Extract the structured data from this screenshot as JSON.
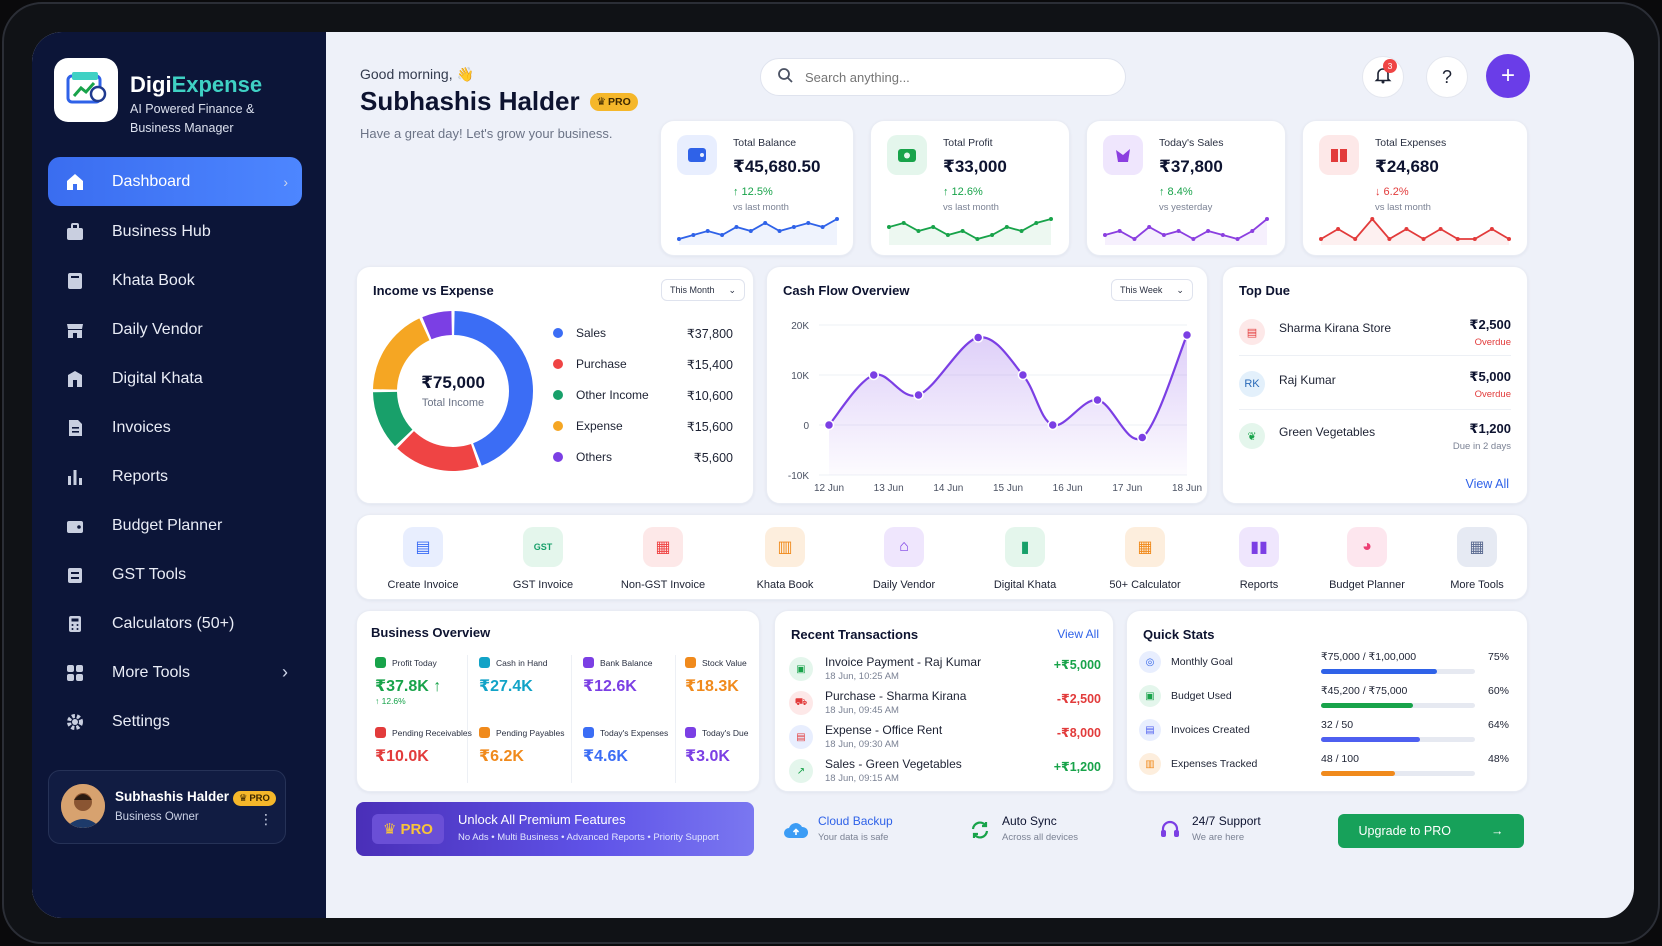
{
  "app": {
    "brand_a": "Digi",
    "brand_b": "Expense",
    "subtitle": "AI Powered Finance & Business Manager"
  },
  "sidebar": {
    "items": [
      {
        "label": "Dashboard",
        "icon": "home-icon"
      },
      {
        "label": "Business Hub",
        "icon": "briefcase-icon"
      },
      {
        "label": "Khata Book",
        "icon": "book-icon"
      },
      {
        "label": "Daily Vendor",
        "icon": "store-icon"
      },
      {
        "label": "Digital Khata",
        "icon": "ledger-icon"
      },
      {
        "label": "Invoices",
        "icon": "invoice-icon"
      },
      {
        "label": "Reports",
        "icon": "bar-chart-icon"
      },
      {
        "label": "Budget Planner",
        "icon": "wallet-icon"
      },
      {
        "label": "GST Tools",
        "icon": "gst-icon"
      },
      {
        "label": "Calculators (50+)",
        "icon": "calculator-icon"
      },
      {
        "label": "More Tools",
        "icon": "grid-icon"
      },
      {
        "label": "Settings",
        "icon": "gear-icon"
      }
    ],
    "user": {
      "name": "Subhashis Halder",
      "role": "Business Owner",
      "badge": "PRO"
    }
  },
  "header": {
    "greeting": "Good morning, 👋",
    "name": "Subhashis Halder",
    "badge": "PRO",
    "tagline": "Have a great day! Let's grow your business.",
    "search_placeholder": "Search anything...",
    "notif_count": "3",
    "help": "?",
    "add": "+"
  },
  "kpis": [
    {
      "label": "Total Balance",
      "value": "₹45,680.50",
      "change": "↑ 12.5%",
      "cmp": "vs last month",
      "color": "#2f62e8",
      "trend": [
        3,
        4,
        5,
        4,
        6,
        5,
        7,
        5,
        6,
        7,
        6,
        8
      ]
    },
    {
      "label": "Total Profit",
      "value": "₹33,000",
      "change": "↑ 12.6%",
      "cmp": "vs last month",
      "color": "#18a34a",
      "trend": [
        5,
        6,
        4,
        5,
        3,
        4,
        2,
        3,
        5,
        4,
        6,
        7
      ]
    },
    {
      "label": "Today's Sales",
      "value": "₹37,800",
      "change": "↑ 8.4%",
      "cmp": "vs yesterday",
      "color": "#8b3fe0",
      "trend": [
        4,
        5,
        3,
        6,
        4,
        5,
        3,
        5,
        4,
        3,
        5,
        8
      ]
    },
    {
      "label": "Total Expenses",
      "value": "₹24,680",
      "change": "↓ 6.2%",
      "cmp": "vs last month",
      "color": "#e23b3b",
      "trend": [
        4,
        5,
        4,
        6,
        4,
        5,
        4,
        5,
        4,
        4,
        5,
        4
      ]
    }
  ],
  "income_expense": {
    "title": "Income vs Expense",
    "period": "This Month",
    "total": "₹75,000",
    "total_label": "Total Income",
    "items": [
      {
        "label": "Sales",
        "value": "₹37,800",
        "amount": 37800,
        "color": "#3b6df5"
      },
      {
        "label": "Purchase",
        "value": "₹15,400",
        "amount": 15400,
        "color": "#ef4444"
      },
      {
        "label": "Other Income",
        "value": "₹10,600",
        "amount": 10600,
        "color": "#18a06a"
      },
      {
        "label": "Expense",
        "value": "₹15,600",
        "amount": 15600,
        "color": "#f5a623"
      },
      {
        "label": "Others",
        "value": "₹5,600",
        "amount": 5600,
        "color": "#7b3fe4"
      }
    ]
  },
  "chart_data": {
    "type": "line",
    "title": "Cash Flow Overview",
    "period": "This Week",
    "x": [
      "12 Jun",
      "13 Jun",
      "14 Jun",
      "15 Jun",
      "16 Jun",
      "17 Jun",
      "18 Jun"
    ],
    "series": [
      {
        "values": [
          0,
          10000,
          6000,
          17500,
          10000,
          0,
          5000,
          -2500,
          18000
        ]
      }
    ],
    "points_x": [
      0,
      0.75,
      1.5,
      2.5,
      3.25,
      3.75,
      4.5,
      5.25,
      6
    ],
    "yticks": [
      "20K",
      "10K",
      "0",
      "-10K"
    ],
    "ylim": [
      -10000,
      20000
    ],
    "color": "#7b3fe4"
  },
  "top_due": {
    "title": "Top Due",
    "items": [
      {
        "name": "Sharma Kirana Store",
        "amount": "₹2,500",
        "status": "Overdue",
        "icon": "store-icon",
        "initials": "",
        "status_color": "#e23b3b"
      },
      {
        "name": "Raj Kumar",
        "amount": "₹5,000",
        "status": "Overdue",
        "icon": "avatar-initials",
        "initials": "RK",
        "status_color": "#e23b3b"
      },
      {
        "name": "Green Vegetables",
        "amount": "₹1,200",
        "status": "Due in 2 days",
        "icon": "leaf-icon",
        "initials": "",
        "status_color": "#7b8294"
      }
    ],
    "view_all": "View All"
  },
  "tools": [
    {
      "label": "Create Invoice",
      "icon": "invoice-icon",
      "color": "#3b6df5",
      "bg": "#e8eefe"
    },
    {
      "label": "GST Invoice",
      "icon": "gst-icon",
      "color": "#18a06a",
      "bg": "#e4f6ec"
    },
    {
      "label": "Non-GST Invoice",
      "icon": "non-gst-icon",
      "color": "#ef4444",
      "bg": "#fde8e8"
    },
    {
      "label": "Khata Book",
      "icon": "book-icon",
      "color": "#f08a1c",
      "bg": "#fdeedd"
    },
    {
      "label": "Daily Vendor",
      "icon": "store-icon",
      "color": "#7b3fe4",
      "bg": "#efe6fd"
    },
    {
      "label": "Digital Khata",
      "icon": "ledger-icon",
      "color": "#18a06a",
      "bg": "#e4f6ec"
    },
    {
      "label": "50+ Calculator",
      "icon": "calculator-icon",
      "color": "#f08a1c",
      "bg": "#fdeedd"
    },
    {
      "label": "Reports",
      "icon": "bar-chart-icon",
      "color": "#7b3fe4",
      "bg": "#efe6fd"
    },
    {
      "label": "Budget Planner",
      "icon": "pie-chart-icon",
      "color": "#ec3f74",
      "bg": "#fde6ee"
    },
    {
      "label": "More Tools",
      "icon": "grid-icon",
      "color": "#5a6a90",
      "bg": "#e6eaf3"
    }
  ],
  "business_overview": {
    "title": "Business Overview",
    "cells": [
      {
        "label": "Profit Today",
        "value": "₹37.8K ↑",
        "change": "↑ 12.6%",
        "color": "#18a34a"
      },
      {
        "label": "Cash in Hand",
        "value": "₹27.4K",
        "change": "",
        "color": "#12a3c7"
      },
      {
        "label": "Bank Balance",
        "value": "₹12.6K",
        "change": "",
        "color": "#7b3fe4"
      },
      {
        "label": "Stock Value",
        "value": "₹18.3K",
        "change": "",
        "color": "#f08a1c"
      },
      {
        "label": "Pending Receivables",
        "value": "₹10.0K",
        "change": "",
        "color": "#e23b3b"
      },
      {
        "label": "Pending Payables",
        "value": "₹6.2K",
        "change": "",
        "color": "#f08a1c"
      },
      {
        "label": "Today's Expenses",
        "value": "₹4.6K",
        "change": "",
        "color": "#3b6df5"
      },
      {
        "label": "Today's Due",
        "value": "₹3.0K",
        "change": "",
        "color": "#7b3fe4"
      }
    ]
  },
  "transactions": {
    "title": "Recent Transactions",
    "view_all": "View All",
    "items": [
      {
        "name": "Invoice Payment - Raj Kumar",
        "date": "18 Jun, 10:25 AM",
        "amount": "+₹5,000",
        "color": "#18a34a",
        "bg": "#e4f6ec",
        "icon": "wallet-icon"
      },
      {
        "name": "Purchase - Sharma Kirana",
        "date": "18 Jun, 09:45 AM",
        "amount": "-₹2,500",
        "color": "#e23b3b",
        "bg": "#fde8e8",
        "icon": "cart-icon"
      },
      {
        "name": "Expense - Office Rent",
        "date": "18 Jun, 09:30 AM",
        "amount": "-₹8,000",
        "color": "#e23b3b",
        "bg": "#e8eefe",
        "icon": "receipt-icon"
      },
      {
        "name": "Sales - Green Vegetables",
        "date": "18 Jun, 09:15 AM",
        "amount": "+₹1,200",
        "color": "#18a34a",
        "bg": "#e4f6ec",
        "icon": "trend-up-icon"
      }
    ]
  },
  "quick_stats": {
    "title": "Quick Stats",
    "items": [
      {
        "label": "Monthly Goal",
        "value": "₹75,000 / ₹1,00,000",
        "percent": "75%",
        "fraction": 0.75,
        "color": "#2f62e8",
        "bg": "#e8eefe"
      },
      {
        "label": "Budget Used",
        "value": "₹45,200 / ₹75,000",
        "percent": "60%",
        "fraction": 0.6,
        "color": "#18a34a",
        "bg": "#e4f6ec"
      },
      {
        "label": "Invoices Created",
        "value": "32 / 50",
        "percent": "64%",
        "fraction": 0.64,
        "color": "#4e5ff0",
        "bg": "#e8eefe"
      },
      {
        "label": "Expenses Tracked",
        "value": "48 / 100",
        "percent": "48%",
        "fraction": 0.48,
        "color": "#f08a1c",
        "bg": "#fdeedd"
      }
    ]
  },
  "footer": {
    "promo_badge": "PRO",
    "promo_title": "Unlock All Premium Features",
    "promo_sub": "No Ads • Multi Business • Advanced Reports • Priority Support",
    "features": [
      {
        "title": "Cloud Backup",
        "sub": "Your data is safe",
        "icon": "cloud-icon"
      },
      {
        "title": "Auto Sync",
        "sub": "Across all devices",
        "icon": "sync-icon"
      },
      {
        "title": "24/7 Support",
        "sub": "We are here",
        "icon": "headset-icon"
      }
    ],
    "upgrade": "Upgrade to PRO"
  }
}
